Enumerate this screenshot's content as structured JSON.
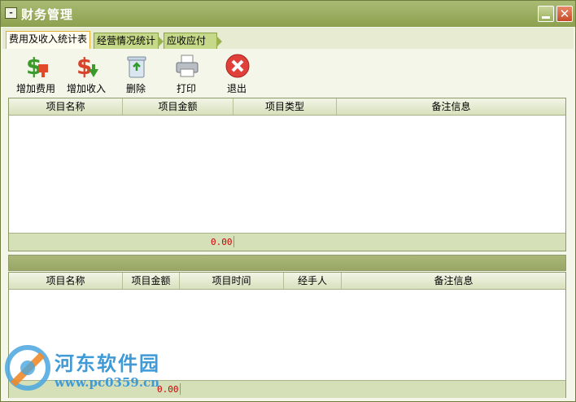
{
  "window": {
    "title": "财务管理"
  },
  "tabs": [
    {
      "label": "费用及收入统计表",
      "active": true
    },
    {
      "label": "经营情况统计",
      "active": false
    },
    {
      "label": "应收应付表",
      "active": false
    }
  ],
  "toolbar": {
    "add_expense": "增加费用",
    "add_income": "增加收入",
    "delete": "删除",
    "print": "打印",
    "exit": "退出"
  },
  "grid1": {
    "columns": [
      "项目名称",
      "项目金额",
      "项目类型",
      "备注信息"
    ],
    "rows": [],
    "total": "0.00"
  },
  "grid2": {
    "columns": [
      "项目名称",
      "项目金额",
      "项目时间",
      "经手人",
      "备注信息"
    ],
    "rows": [],
    "total": "0.00"
  },
  "watermark": {
    "name": "河东软件园",
    "url": "www.pc0359.cn"
  },
  "colors": {
    "titlebar": "#98ab5e",
    "tab_inactive": "#c6d88a",
    "tab_active_border": "#e2b13a",
    "total_text": "#cc0000",
    "watermark": "#3f9ad6"
  }
}
